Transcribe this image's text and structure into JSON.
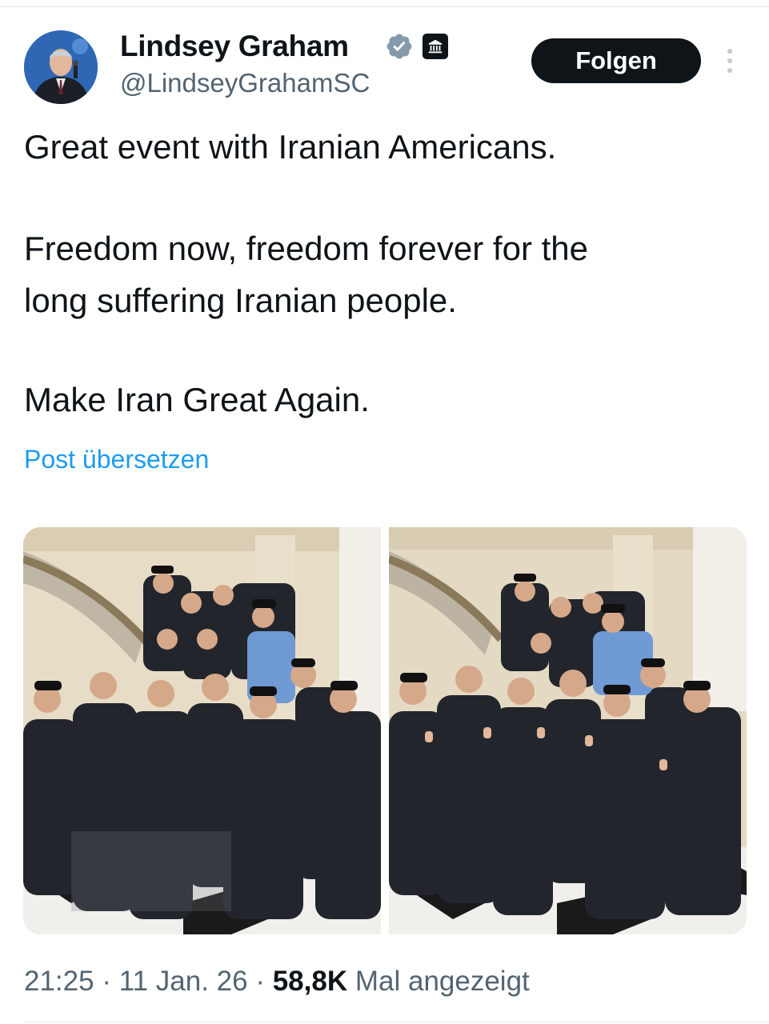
{
  "author": {
    "display_name": "Lindsey Graham",
    "handle": "@LindseyGrahamSC",
    "verified_icon": "verified-badge-icon",
    "affiliation_icon": "government-building-icon"
  },
  "actions": {
    "follow_label": "Folgen",
    "more_icon": "more-vertical-icon"
  },
  "tweet": {
    "line1": "Great event with Iranian Americans.",
    "line2": "Freedom now, freedom forever for the",
    "line3": "long suffering Iranian people.",
    "line4": "Make Iran Great Again.",
    "translate_label": "Post übersetzen"
  },
  "media": {
    "count": 2
  },
  "meta": {
    "time": "21:25",
    "separator": "·",
    "date": "11 Jan. 26",
    "views_count": "58,8K",
    "views_label": "Mal angezeigt"
  },
  "colors": {
    "text": "#0f1419",
    "secondary": "#536471",
    "link": "#1d9bf0",
    "verified": "#829aab"
  }
}
